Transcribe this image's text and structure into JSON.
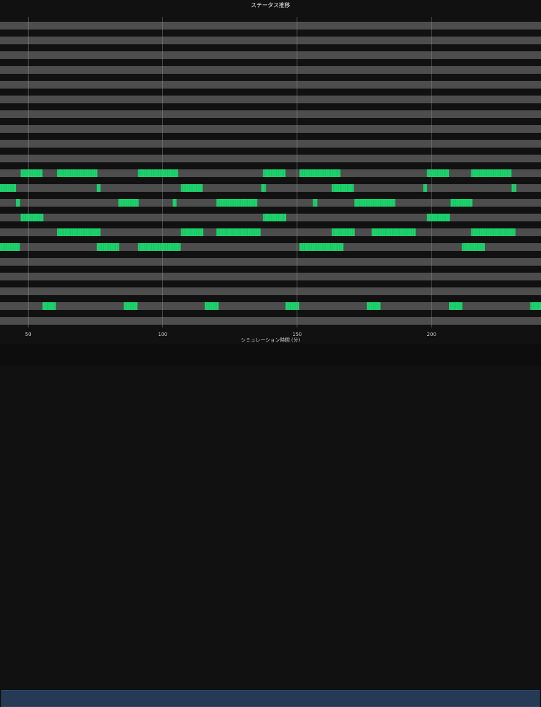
{
  "chart_data": {
    "type": "timeline",
    "title": "ステータス推移",
    "xlabel": "シミュレーション時間 (分)",
    "ylabel": "",
    "xlim": [
      39.5,
      240.7
    ],
    "xticks": [
      50,
      100,
      150,
      200
    ],
    "grid": true,
    "row_count": 21,
    "colors": {
      "idle": "#4d4d4d",
      "active": "#1ed36d",
      "separator": "#111111",
      "grid": "#9a9a9a",
      "background": "#111111"
    },
    "rows": [
      {
        "row": 0,
        "active": []
      },
      {
        "row": 1,
        "active": []
      },
      {
        "row": 2,
        "active": []
      },
      {
        "row": 3,
        "active": []
      },
      {
        "row": 4,
        "active": []
      },
      {
        "row": 5,
        "active": []
      },
      {
        "row": 6,
        "active": []
      },
      {
        "row": 7,
        "active": []
      },
      {
        "row": 8,
        "active": []
      },
      {
        "row": 9,
        "active": []
      },
      {
        "row": 10,
        "active": [
          [
            47.2,
            55.3
          ],
          [
            60.7,
            75.7
          ],
          [
            90.8,
            105.7
          ],
          [
            137.3,
            145.7
          ],
          [
            150.9,
            166.1
          ],
          [
            198.3,
            206.5
          ],
          [
            214.7,
            229.7
          ]
        ]
      },
      {
        "row": 11,
        "active": [
          [
            39.5,
            45.5
          ],
          [
            75.5,
            76.9
          ],
          [
            106.8,
            114.9
          ],
          [
            136.7,
            138.4
          ],
          [
            162.9,
            171.1
          ],
          [
            196.9,
            198.3
          ],
          [
            229.8,
            231.5
          ]
        ]
      },
      {
        "row": 12,
        "active": [
          [
            45.5,
            46.9
          ],
          [
            83.5,
            91.1
          ],
          [
            103.7,
            105.2
          ],
          [
            120.0,
            135.2
          ],
          [
            155.9,
            157.5
          ],
          [
            171.3,
            186.5
          ],
          [
            207.1,
            215.2
          ]
        ]
      },
      {
        "row": 13,
        "active": [
          [
            47.2,
            55.6
          ],
          [
            137.3,
            145.9
          ],
          [
            198.3,
            206.8
          ]
        ]
      },
      {
        "row": 14,
        "active": [
          [
            60.7,
            76.9
          ],
          [
            106.8,
            115.1
          ],
          [
            120.0,
            136.4
          ],
          [
            162.9,
            171.4
          ],
          [
            177.7,
            194.1
          ],
          [
            214.7,
            231.2
          ]
        ]
      },
      {
        "row": 15,
        "active": [
          [
            39.5,
            46.9
          ],
          [
            75.5,
            83.8
          ],
          [
            90.8,
            106.7
          ],
          [
            150.9,
            167.2
          ],
          [
            211.3,
            219.8
          ]
        ]
      },
      {
        "row": 16,
        "active": []
      },
      {
        "row": 17,
        "active": []
      },
      {
        "row": 18,
        "active": []
      },
      {
        "row": 19,
        "active": [
          [
            55.3,
            60.3
          ],
          [
            85.5,
            90.6
          ],
          [
            115.7,
            120.8
          ],
          [
            145.7,
            150.8
          ],
          [
            175.9,
            181.0
          ],
          [
            206.5,
            211.5
          ],
          [
            236.7,
            240.7
          ]
        ]
      },
      {
        "row": 20,
        "active": []
      }
    ]
  }
}
